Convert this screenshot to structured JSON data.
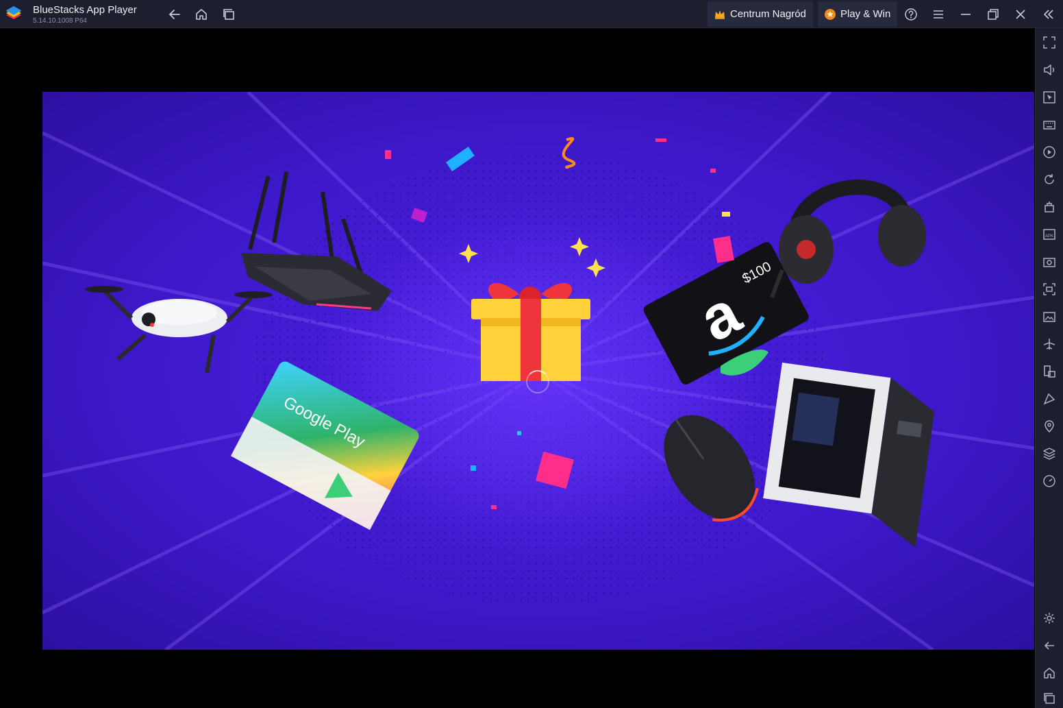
{
  "titlebar": {
    "app_name": "BlueStacks App Player",
    "version": "5.14.10.1008  P64",
    "nav": {
      "back_icon": "back-arrow-icon",
      "home_icon": "home-icon",
      "recents_icon": "recent-apps-icon"
    },
    "rewards_label": "Centrum Nagród",
    "rewards_icon": "crown-icon",
    "play_win_label": "Play & Win",
    "play_win_icon": "star-badge-icon",
    "window_controls": [
      "help-icon",
      "menu-icon",
      "minimize-icon",
      "restore-icon",
      "close-icon",
      "collapse-sidebar-icon"
    ]
  },
  "sidebar": {
    "top_tools": [
      "fullscreen-icon",
      "volume-icon",
      "pointer-lock-icon",
      "keyboard-icon",
      "macro-icon",
      "rotate-icon",
      "shake-icon",
      "install-apk-icon",
      "screenshot-icon",
      "record-screen-icon",
      "media-folder-icon",
      "airplane-mode-icon",
      "multi-instance-icon",
      "eco-mode-icon",
      "location-icon",
      "layers-icon",
      "performance-icon"
    ],
    "bottom_tools": [
      "settings-icon",
      "android-back-icon",
      "android-home-icon",
      "android-recents-icon"
    ]
  },
  "game_scene": {
    "gift_card_amount": "$100",
    "gift_card_brand_letter": "a",
    "google_play_label": "Google Play",
    "background_color": "#3f1ecf",
    "accent_colors": [
      "#ffd23c",
      "#f0343c",
      "#ff2e8a",
      "#1fb0ff"
    ]
  }
}
